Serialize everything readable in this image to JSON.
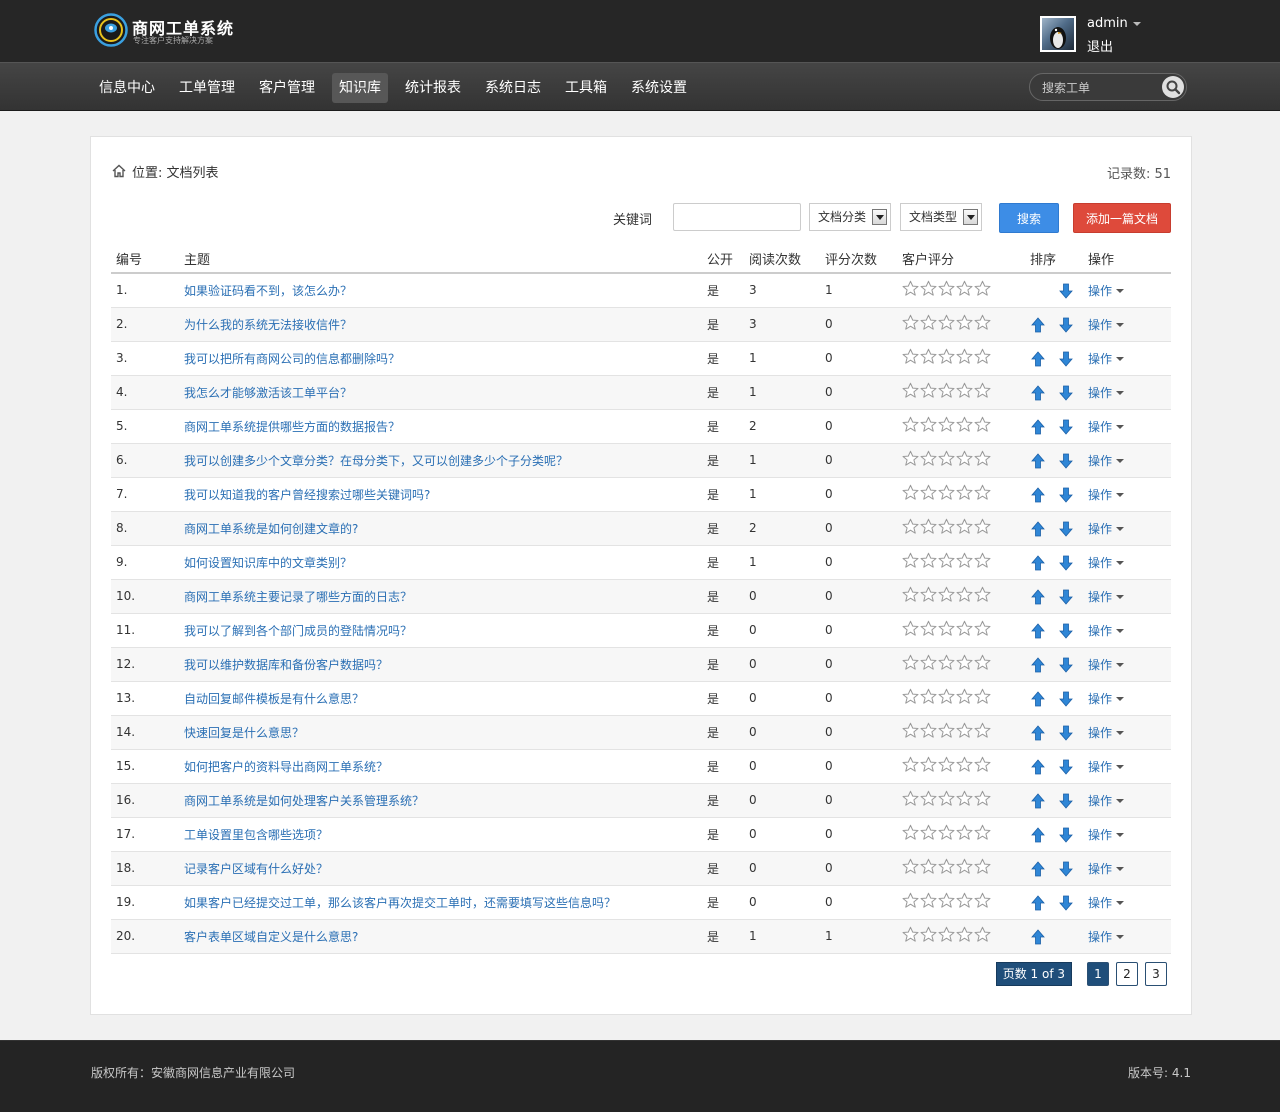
{
  "header": {
    "app_title": "商网工单系统",
    "app_subtitle": "专注客户支持解决方案",
    "user_name": "admin",
    "logout_label": "退出",
    "search_placeholder": "搜索工单"
  },
  "nav": {
    "items": [
      "信息中心",
      "工单管理",
      "客户管理",
      "知识库",
      "统计报表",
      "系统日志",
      "工具箱",
      "系统设置"
    ],
    "active": "知识库"
  },
  "page": {
    "breadcrumb": "位置: 文档列表",
    "record_count": "记录数: 51"
  },
  "filter": {
    "keyword_label": "关键词",
    "keyword_value": "",
    "category_select": "文档分类",
    "type_select": "文档类型",
    "search_button": "搜索",
    "add_button": "添加一篇文档"
  },
  "table": {
    "columns": [
      "编号",
      "主题",
      "公开",
      "阅读次数",
      "评分次数",
      "客户评分",
      "排序",
      "操作"
    ],
    "op_label": "操作",
    "rows": [
      {
        "no": "1.",
        "subject": "如果验证码看不到，该怎么办？",
        "public": "是",
        "reads": "3",
        "ratings": "1",
        "stars": 0,
        "up": false,
        "down": true
      },
      {
        "no": "2.",
        "subject": "为什么我的系统无法接收信件？",
        "public": "是",
        "reads": "3",
        "ratings": "0",
        "stars": 0,
        "up": true,
        "down": true
      },
      {
        "no": "3.",
        "subject": "我可以把所有商网公司的信息都删除吗？",
        "public": "是",
        "reads": "1",
        "ratings": "0",
        "stars": 0,
        "up": true,
        "down": true
      },
      {
        "no": "4.",
        "subject": "我怎么才能够激活该工单平台？",
        "public": "是",
        "reads": "1",
        "ratings": "0",
        "stars": 0,
        "up": true,
        "down": true
      },
      {
        "no": "5.",
        "subject": "商网工单系统提供哪些方面的数据报告？",
        "public": "是",
        "reads": "2",
        "ratings": "0",
        "stars": 0,
        "up": true,
        "down": true
      },
      {
        "no": "6.",
        "subject": "我可以创建多少个文章分类？在母分类下，又可以创建多少个子分类呢？",
        "public": "是",
        "reads": "1",
        "ratings": "0",
        "stars": 0,
        "up": true,
        "down": true
      },
      {
        "no": "7.",
        "subject": "我可以知道我的客户曾经搜索过哪些关键词吗?",
        "public": "是",
        "reads": "1",
        "ratings": "0",
        "stars": 0,
        "up": true,
        "down": true
      },
      {
        "no": "8.",
        "subject": "商网工单系统是如何创建文章的?",
        "public": "是",
        "reads": "2",
        "ratings": "0",
        "stars": 0,
        "up": true,
        "down": true
      },
      {
        "no": "9.",
        "subject": "如何设置知识库中的文章类别？",
        "public": "是",
        "reads": "1",
        "ratings": "0",
        "stars": 0,
        "up": true,
        "down": true
      },
      {
        "no": "10.",
        "subject": "商网工单系统主要记录了哪些方面的日志？",
        "public": "是",
        "reads": "0",
        "ratings": "0",
        "stars": 0,
        "up": true,
        "down": true
      },
      {
        "no": "11.",
        "subject": "我可以了解到各个部门成员的登陆情况吗？",
        "public": "是",
        "reads": "0",
        "ratings": "0",
        "stars": 0,
        "up": true,
        "down": true
      },
      {
        "no": "12.",
        "subject": "我可以维护数据库和备份客户数据吗？",
        "public": "是",
        "reads": "0",
        "ratings": "0",
        "stars": 0,
        "up": true,
        "down": true
      },
      {
        "no": "13.",
        "subject": "自动回复邮件模板是有什么意思？",
        "public": "是",
        "reads": "0",
        "ratings": "0",
        "stars": 0,
        "up": true,
        "down": true
      },
      {
        "no": "14.",
        "subject": "快速回复是什么意思？",
        "public": "是",
        "reads": "0",
        "ratings": "0",
        "stars": 0,
        "up": true,
        "down": true
      },
      {
        "no": "15.",
        "subject": "如何把客户的资料导出商网工单系统？",
        "public": "是",
        "reads": "0",
        "ratings": "0",
        "stars": 0,
        "up": true,
        "down": true
      },
      {
        "no": "16.",
        "subject": "商网工单系统是如何处理客户关系管理系统？",
        "public": "是",
        "reads": "0",
        "ratings": "0",
        "stars": 0,
        "up": true,
        "down": true
      },
      {
        "no": "17.",
        "subject": "工单设置里包含哪些选项？",
        "public": "是",
        "reads": "0",
        "ratings": "0",
        "stars": 0,
        "up": true,
        "down": true
      },
      {
        "no": "18.",
        "subject": "记录客户区域有什么好处？",
        "public": "是",
        "reads": "0",
        "ratings": "0",
        "stars": 0,
        "up": true,
        "down": true
      },
      {
        "no": "19.",
        "subject": "如果客户已经提交过工单，那么该客户再次提交工单时，还需要填写这些信息吗？",
        "public": "是",
        "reads": "0",
        "ratings": "0",
        "stars": 0,
        "up": true,
        "down": true
      },
      {
        "no": "20.",
        "subject": "客户表单区域自定义是什么意思?",
        "public": "是",
        "reads": "1",
        "ratings": "1",
        "stars": 0,
        "up": true,
        "down": false
      }
    ]
  },
  "pagination": {
    "info": "页数 1 of 3",
    "pages": [
      "1",
      "2",
      "3"
    ],
    "current": "1"
  },
  "footer": {
    "copyright": "版权所有：安徽商网信息产业有限公司",
    "version": "版本号: 4.1"
  },
  "colors": {
    "topbar": "#262626",
    "link": "#2a6fb4",
    "search_button": "#3d8de6",
    "add_button": "#de4a3b",
    "pager_active": "#1f4e7a",
    "arrow": "#2f86d6"
  },
  "icons": {
    "logo": "logo-icon",
    "home": "home-icon",
    "search": "search-icon",
    "sort_up": "arrow-up-icon",
    "sort_down": "arrow-down-icon",
    "star": "star-outline-icon",
    "caret": "caret-down-icon"
  }
}
